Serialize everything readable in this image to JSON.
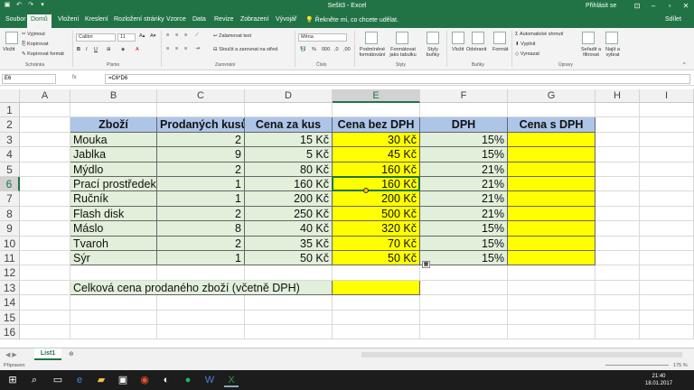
{
  "window": {
    "title": "Sešit3 - Excel",
    "signin": "Přihlásit se"
  },
  "tabs": [
    "Soubor",
    "Domů",
    "Vložení",
    "Kreslení",
    "Rozložení stránky",
    "Vzorce",
    "Data",
    "Revize",
    "Zobrazení",
    "Vývojář"
  ],
  "active_tab": "Domů",
  "tell_me": "Řekněte mi, co chcete udělat.",
  "share": "Sdílet",
  "ribbon": {
    "paste": "Vložit",
    "cut": "Vyjmout",
    "copy": "Kopírovat",
    "format_painter": "Kopírovat formát",
    "clipboard_group": "Schránka",
    "font_name": "Calibri",
    "font_size": "11",
    "font_group": "Písmo",
    "wrap_text": "Zalamovat text",
    "merge_center": "Sloučit a zarovnat na střed",
    "alignment_group": "Zarovnání",
    "number_format": "Měna",
    "number_group": "Číslo",
    "conditional_formatting": "Podmíněné formátování",
    "format_as_table": "Formátovat jako tabulku",
    "cell_styles": "Styly buňky",
    "styles_group": "Styly",
    "insert": "Vložit",
    "delete": "Odstranit",
    "format": "Formát",
    "cells_group": "Buňky",
    "autosum": "Automatické shrnutí",
    "fill": "Vyplnit",
    "clear": "Vymazat",
    "sort_filter": "Seřadit a filtrovat",
    "find_select": "Najít a vybrat",
    "editing_group": "Úpravy"
  },
  "formula_bar": {
    "name_box": "E6",
    "fx": "fx",
    "formula": "=C6*D6"
  },
  "columns": [
    "A",
    "B",
    "C",
    "D",
    "E",
    "F",
    "G",
    "H",
    "I"
  ],
  "selected_column": "E",
  "rows": [
    "1",
    "2",
    "3",
    "4",
    "5",
    "6",
    "7",
    "8",
    "9",
    "10",
    "11",
    "12",
    "13",
    "14",
    "15",
    "16"
  ],
  "selected_row": "6",
  "table": {
    "headers": [
      "Zboží",
      "Prodaných kusů",
      "Cena za kus",
      "Cena bez DPH",
      "DPH",
      "Cena s DPH"
    ],
    "rows": [
      [
        "Mouka",
        "2",
        "15 Kč",
        "30 Kč",
        "15%",
        ""
      ],
      [
        "Jablka",
        "9",
        "5 Kč",
        "45 Kč",
        "15%",
        ""
      ],
      [
        "Mýdlo",
        "2",
        "80 Kč",
        "160 Kč",
        "21%",
        ""
      ],
      [
        "Prací prostředek",
        "1",
        "160 Kč",
        "160 Kč",
        "21%",
        ""
      ],
      [
        "Ručník",
        "1",
        "200 Kč",
        "200 Kč",
        "21%",
        ""
      ],
      [
        "Flash disk",
        "2",
        "250 Kč",
        "500 Kč",
        "21%",
        ""
      ],
      [
        "Máslo",
        "8",
        "40 Kč",
        "320 Kč",
        "15%",
        ""
      ],
      [
        "Tvaroh",
        "2",
        "35 Kč",
        "70 Kč",
        "15%",
        ""
      ],
      [
        "Sýr",
        "1",
        "50 Kč",
        "50 Kč",
        "15%",
        ""
      ]
    ],
    "total_label": "Celková cena prodaného zboží (včetně DPH)"
  },
  "sheet": {
    "name": "List1"
  },
  "status": {
    "ready": "Připraven",
    "zoom": "175 %"
  },
  "taskbar": {
    "time": "21:40",
    "date": "18.01.2017"
  }
}
